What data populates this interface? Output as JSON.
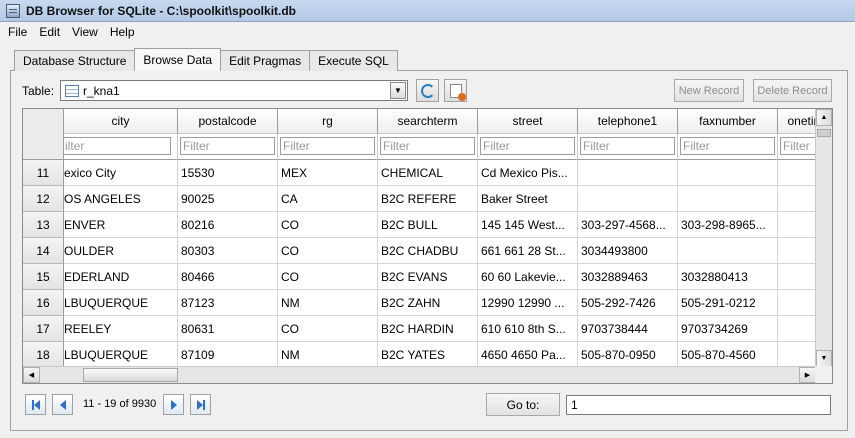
{
  "window": {
    "title": "DB Browser for SQLite - C:\\spoolkit\\spoolkit.db"
  },
  "menu": [
    "File",
    "Edit",
    "View",
    "Help"
  ],
  "tabs": [
    "Database Structure",
    "Browse Data",
    "Edit Pragmas",
    "Execute SQL"
  ],
  "active_tab": "Browse Data",
  "toolbar": {
    "table_label": "Table:",
    "table_value": "r_kna1",
    "new_record": "New Record",
    "delete_record": "Delete Record",
    "icons": [
      "refresh-icon",
      "clear-filters-icon"
    ]
  },
  "grid": {
    "columns": [
      "city",
      "postalcode",
      "rg",
      "searchterm",
      "street",
      "telephone1",
      "faxnumber",
      "onetim"
    ],
    "filter_placeholder": "Filter",
    "first_filter_visible": "ilter",
    "rows": [
      {
        "num": "11",
        "cells": [
          "exico City",
          "15530",
          "MEX",
          "CHEMICAL",
          "Cd Mexico Pis...",
          "",
          "",
          ""
        ]
      },
      {
        "num": "12",
        "cells": [
          "OS ANGELES",
          "90025",
          "CA",
          "B2C REFERE",
          "Baker Street",
          "",
          "",
          ""
        ]
      },
      {
        "num": "13",
        "cells": [
          "ENVER",
          "80216",
          "CO",
          "B2C BULL",
          "145 145 West...",
          "303-297-4568...",
          "303-298-8965...",
          ""
        ]
      },
      {
        "num": "14",
        "cells": [
          "OULDER",
          "80303",
          "CO",
          "B2C CHADBU",
          "661 661 28 St...",
          "3034493800",
          "",
          ""
        ]
      },
      {
        "num": "15",
        "cells": [
          "EDERLAND",
          "80466",
          "CO",
          "B2C EVANS",
          "60 60 Lakevie...",
          "3032889463",
          "3032880413",
          ""
        ]
      },
      {
        "num": "16",
        "cells": [
          "LBUQUERQUE",
          "87123",
          "NM",
          "B2C ZAHN",
          "12990 12990 ...",
          "505-292-7426",
          "505-291-0212",
          ""
        ]
      },
      {
        "num": "17",
        "cells": [
          "REELEY",
          "80631",
          "CO",
          "B2C HARDIN",
          "610 610 8th S...",
          "9703738444",
          "9703734269",
          ""
        ]
      },
      {
        "num": "18",
        "cells": [
          "LBUQUERQUE",
          "87109",
          "NM",
          "B2C YATES",
          "4650 4650 Pa...",
          "505-870-0950",
          "505-870-4560",
          ""
        ]
      }
    ]
  },
  "footer": {
    "record_range": "11 - 19 of 9930",
    "goto_label": "Go to:",
    "goto_value": "1"
  }
}
